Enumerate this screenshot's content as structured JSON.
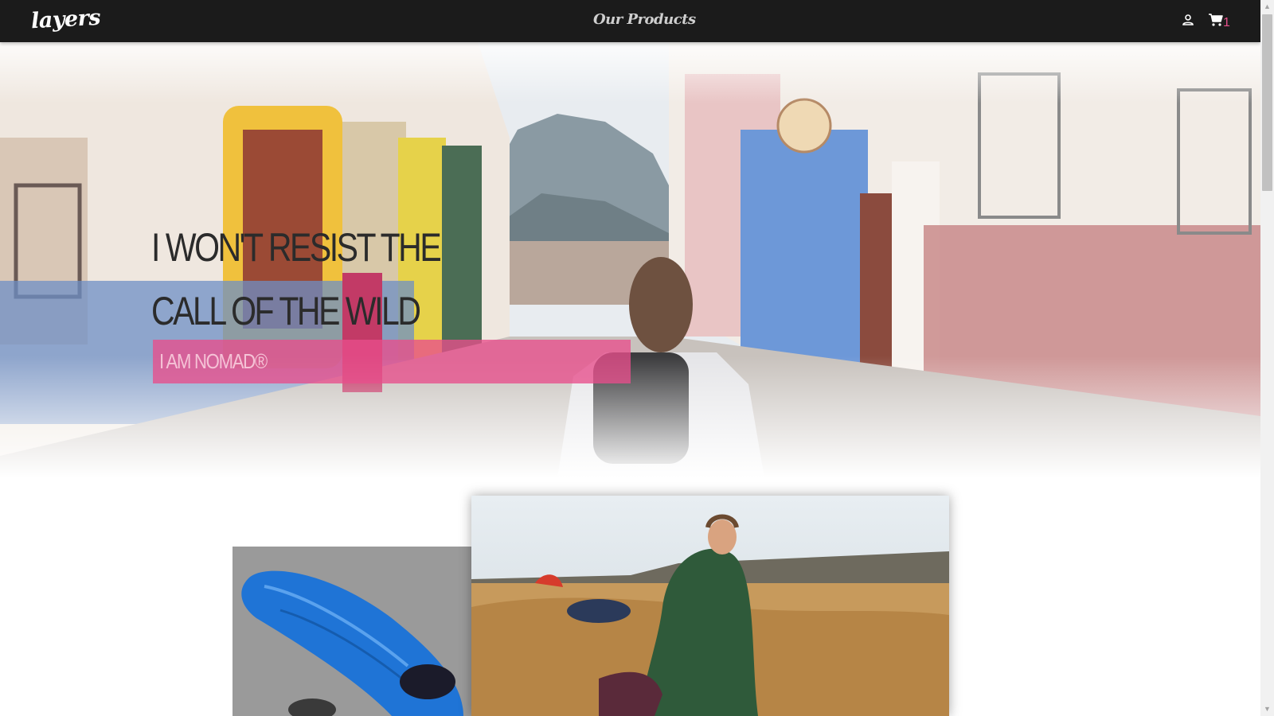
{
  "nav": {
    "brand": "layers",
    "center_link": "Our Products",
    "user_icon": "user-icon",
    "cart_icon": "cart-icon",
    "cart_count": "1"
  },
  "hero": {
    "line1": "I WON'T RESIST THE",
    "line2": "CALL OF THE WILD",
    "tagline": "I AM NOMAD®",
    "tag_color": "#e84e8c",
    "image": "woman with backpack walking down colorful colonial street"
  },
  "products": {
    "left_image": "blue sleeping bag",
    "main_image": "woman in green sleeping bag on desert cliff"
  },
  "colors": {
    "nav_bg": "#1b1b1b",
    "accent": "#e5508a"
  }
}
